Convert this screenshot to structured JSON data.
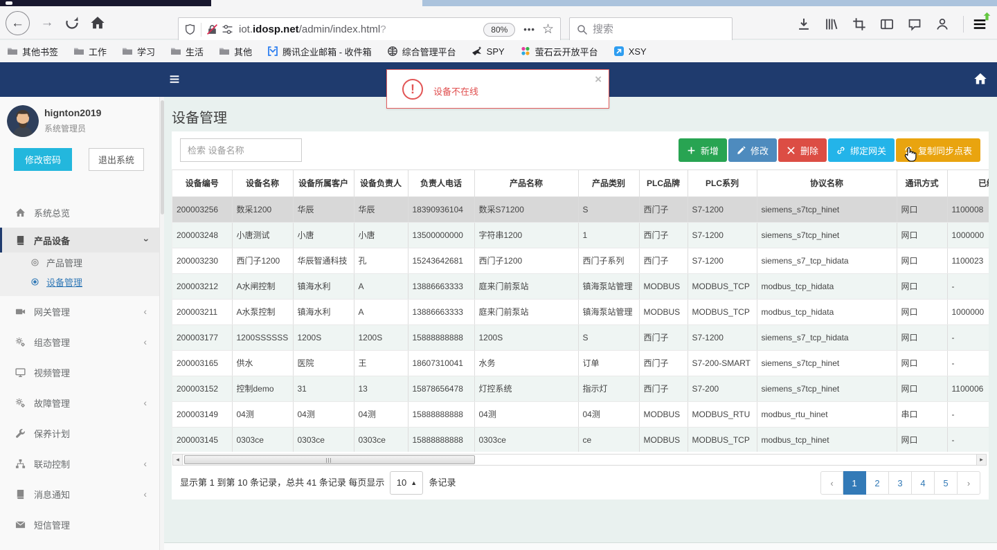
{
  "browser": {
    "url": {
      "pre": "iot.",
      "host": "idosp.net",
      "path": "/admin/index.html",
      "query": "?"
    },
    "zoom_badge": "80%",
    "search_placeholder": "搜索",
    "bookmarks": [
      {
        "label": "其他书签",
        "icon": "folder"
      },
      {
        "label": "工作",
        "icon": "folder"
      },
      {
        "label": "学习",
        "icon": "folder"
      },
      {
        "label": "生活",
        "icon": "folder"
      },
      {
        "label": "其他",
        "icon": "folder"
      },
      {
        "label": "腾讯企业邮箱 - 收件箱",
        "icon": "exmail"
      },
      {
        "label": "综合管理平台",
        "icon": "globe"
      },
      {
        "label": "SPY",
        "icon": "spy"
      },
      {
        "label": "萤石云开放平台",
        "icon": "ezviz"
      },
      {
        "label": "XSY",
        "icon": "xsy"
      }
    ]
  },
  "alert": {
    "message": "设备不在线",
    "close": "×",
    "accent_color": "#e25555"
  },
  "sidebar": {
    "user": {
      "name": "hignton2019",
      "role": "系统管理员"
    },
    "actions": [
      {
        "label": "修改密码",
        "color": "#23b7dd"
      },
      {
        "label": "退出系统",
        "color": "#ffffff"
      }
    ],
    "menu": [
      {
        "label": "系统总览",
        "icon": "home"
      },
      {
        "label": "产品设备",
        "icon": "book",
        "expanded": true,
        "active": true,
        "children": [
          {
            "label": "产品管理",
            "icon": "circle-o",
            "selected": false
          },
          {
            "label": "设备管理",
            "icon": "circle-dot",
            "selected": true
          }
        ]
      },
      {
        "label": "网关管理",
        "icon": "video",
        "collapsible": true
      },
      {
        "label": "组态管理",
        "icon": "gears",
        "collapsible": true
      },
      {
        "label": "视频管理",
        "icon": "monitor"
      },
      {
        "label": "故障管理",
        "icon": "gears",
        "collapsible": true
      },
      {
        "label": "保养计划",
        "icon": "wrench"
      },
      {
        "label": "联动控制",
        "icon": "sitemap",
        "collapsible": true
      },
      {
        "label": "消息通知",
        "icon": "book",
        "collapsible": true
      },
      {
        "label": "短信管理",
        "icon": "envelope"
      }
    ]
  },
  "main": {
    "title": "设备管理",
    "search_placeholder": "检索 设备名称",
    "buttons": [
      {
        "label": "新增",
        "icon": "plus",
        "color": "#28a452"
      },
      {
        "label": "修改",
        "icon": "pencil",
        "color": "#4e8bbe"
      },
      {
        "label": "删除",
        "icon": "cross",
        "color": "#dc4d44"
      },
      {
        "label": "绑定网关",
        "icon": "link",
        "color": "#23b4e9"
      },
      {
        "label": "复制同步点表",
        "icon": "sync",
        "color": "#e9a40f"
      }
    ],
    "table": {
      "columns": [
        "设备编号",
        "设备名称",
        "设备所属客户",
        "设备负责人",
        "负责人电话",
        "产品名称",
        "产品类别",
        "PLC品牌",
        "PLC系列",
        "协议名称",
        "通讯方式",
        "已绑定网关"
      ],
      "selected_row_index": 0,
      "rows": [
        [
          "200003256",
          "数采1200",
          "华辰",
          "华辰",
          "18390936104",
          "数采S71200",
          "S",
          "西门子",
          "S7-1200",
          "siemens_s7tcp_hinet",
          "网口",
          "1100008"
        ],
        [
          "200003248",
          "小唐测试",
          "小唐",
          "小唐",
          "13500000000",
          "字符串1200",
          "1",
          "西门子",
          "S7-1200",
          "siemens_s7tcp_hinet",
          "网口",
          "1000000"
        ],
        [
          "200003230",
          "西门子1200",
          "华辰智通科技",
          "孔",
          "15243642681",
          "西门子1200",
          "西门子系列",
          "西门子",
          "S7-1200",
          "siemens_s7_tcp_hidata",
          "网口",
          "1100023"
        ],
        [
          "200003212",
          "A水闸控制",
          "镇海水利",
          "A",
          "13886663333",
          "庭来门前泵站",
          "镇海泵站管理",
          "MODBUS",
          "MODBUS_TCP",
          "modbus_tcp_hidata",
          "网口",
          "-"
        ],
        [
          "200003211",
          "A水泵控制",
          "镇海水利",
          "A",
          "13886663333",
          "庭来门前泵站",
          "镇海泵站管理",
          "MODBUS",
          "MODBUS_TCP",
          "modbus_tcp_hidata",
          "网口",
          "1000000"
        ],
        [
          "200003177",
          "1200SSSSSS",
          "1200S",
          "1200S",
          "15888888888",
          "1200S",
          "S",
          "西门子",
          "S7-1200",
          "siemens_s7_tcp_hidata",
          "网口",
          "-"
        ],
        [
          "200003165",
          "供水",
          "医院",
          "王",
          "18607310041",
          "水务",
          "订单",
          "西门子",
          "S7-200-SMART",
          "siemens_s7tcp_hinet",
          "网口",
          "-"
        ],
        [
          "200003152",
          "控制demo",
          "31",
          "13",
          "15878656478",
          "灯控系统",
          "指示灯",
          "西门子",
          "S7-200",
          "siemens_s7tcp_hinet",
          "网口",
          "1100006"
        ],
        [
          "200003149",
          "04测",
          "04测",
          "04测",
          "15888888888",
          "04测",
          "04测",
          "MODBUS",
          "MODBUS_RTU",
          "modbus_rtu_hinet",
          "串口",
          "-"
        ],
        [
          "200003145",
          "0303ce",
          "0303ce",
          "0303ce",
          "15888888888",
          "0303ce",
          "ce",
          "MODBUS",
          "MODBUS_TCP",
          "modbus_tcp_hinet",
          "网口",
          "-"
        ]
      ]
    },
    "pagination": {
      "info_prefix": "显示第 1 到第 10 条记录，总共 41 条记录 每页显示",
      "page_size": "10",
      "info_suffix": "条记录",
      "prev": "‹",
      "next": "›",
      "pages": [
        "1",
        "2",
        "3",
        "4",
        "5"
      ],
      "active_page": "1",
      "active_color": "#337ab7"
    }
  }
}
